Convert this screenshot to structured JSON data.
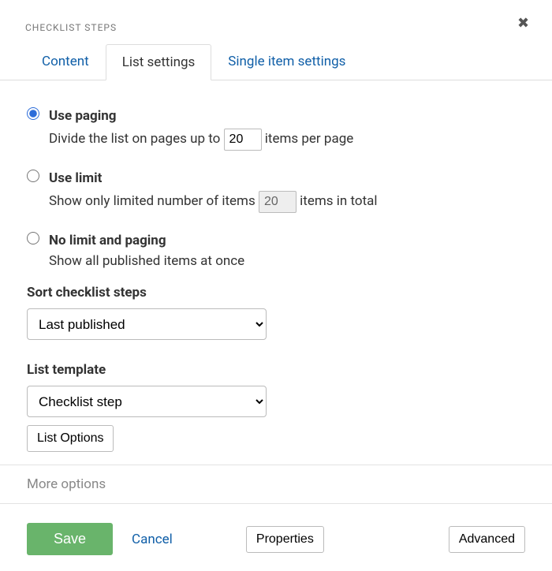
{
  "header": {
    "title": "CHECKLIST STEPS"
  },
  "tabs": {
    "content": "Content",
    "list_settings": "List settings",
    "single_item": "Single item settings",
    "active": "list_settings"
  },
  "options": {
    "use_paging": {
      "title": "Use paging",
      "desc_pre": "Divide the list on pages up to ",
      "value": "20",
      "desc_post": " items per page",
      "selected": true
    },
    "use_limit": {
      "title": "Use limit",
      "desc_pre": "Show only limited number of items ",
      "value": "20",
      "desc_post": " items in total",
      "selected": false
    },
    "no_limit": {
      "title": "No limit and paging",
      "desc": "Show all published items at once",
      "selected": false
    }
  },
  "sort": {
    "label": "Sort checklist steps",
    "selected": "Last published"
  },
  "template": {
    "label": "List template",
    "selected": "Checklist step",
    "options_button": "List Options"
  },
  "more_options_label": "More options",
  "footer": {
    "save": "Save",
    "cancel": "Cancel",
    "properties": "Properties",
    "advanced": "Advanced"
  }
}
